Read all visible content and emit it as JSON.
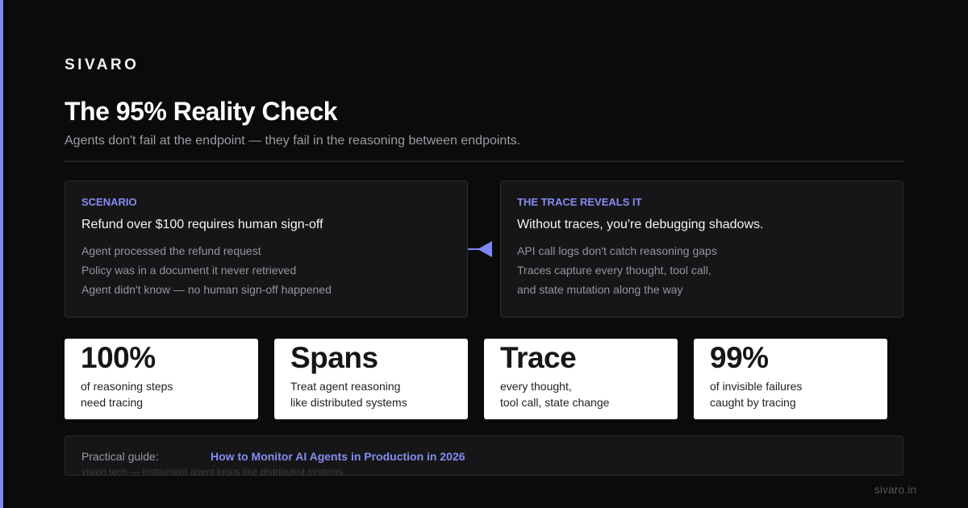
{
  "brand": "SIVARO",
  "title": "The 95% Reality Check",
  "subtitle": "Agents don't fail at the endpoint — they fail in the reasoning between endpoints.",
  "colors": {
    "accent": "#7f87f5",
    "label": "#868cf0",
    "background": "#0b0b0c",
    "card": "#161618",
    "stat_card": "#ffffff"
  },
  "scenario": {
    "label": "SCENARIO",
    "heading": "Refund over $100 requires human sign-off",
    "lines": [
      "Agent processed the refund request",
      "Policy was in a document it never retrieved",
      "Agent didn't know — no human sign-off happened"
    ]
  },
  "connector_icon": "arrow-left-icon",
  "trace": {
    "label": "THE TRACE REVEALS IT",
    "heading": "Without traces, you're debugging shadows.",
    "lines": [
      "API call logs don't catch reasoning gaps",
      "Traces capture every thought, tool call,",
      "and state mutation along the way"
    ]
  },
  "stats": [
    {
      "value": "100%",
      "line1": "of reasoning steps",
      "line2": "need tracing"
    },
    {
      "value": "Spans",
      "line1": "Treat agent reasoning",
      "line2": "like distributed systems"
    },
    {
      "value": "Trace",
      "line1": "every thought,",
      "line2": "tool call, state change"
    },
    {
      "value": "99%",
      "line1": "of invisible failures",
      "line2": "caught by tracing"
    }
  ],
  "guide": {
    "label": "Practical guide:",
    "link_text": "How to Monitor AI Agents in Production in 2026",
    "subtext": "vision.tech — instrument agent loops like distributed systems"
  },
  "footer": {
    "url": "sivaro.in"
  }
}
